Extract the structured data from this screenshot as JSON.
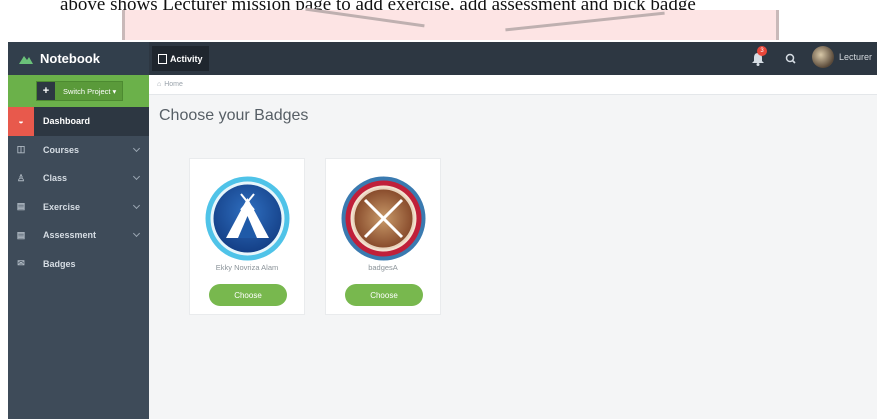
{
  "caption": {
    "text": "above shows Lecturer mission page to add exercise, add assessment and pick badge"
  },
  "topbar": {
    "brand": "Notebook",
    "activity_tab": "Activity",
    "notification_count": "3",
    "user_name": "Lecturer"
  },
  "sidebar": {
    "switch_project": "Switch Project",
    "items": [
      {
        "label": "Dashboard",
        "icon": "dashboard-icon",
        "active": true
      },
      {
        "label": "Courses",
        "icon": "columns-icon",
        "has_submenu": true
      },
      {
        "label": "Class",
        "icon": "user-icon",
        "has_submenu": true
      },
      {
        "label": "Exercise",
        "icon": "file-icon",
        "has_submenu": true
      },
      {
        "label": "Assessment",
        "icon": "file-icon",
        "has_submenu": true
      },
      {
        "label": "Badges",
        "icon": "envelope-icon"
      }
    ]
  },
  "main": {
    "breadcrumb": "Home",
    "title": "Choose your Badges",
    "badges": [
      {
        "name": "Ekky Novriza Alam",
        "button": "Choose",
        "icon": "tent-badge-icon"
      },
      {
        "name": "badgesA",
        "button": "Choose",
        "icon": "crossed-swords-badge-icon"
      }
    ]
  },
  "colors": {
    "topbar": "#2d3742",
    "sidebar": "#3e4b59",
    "accent_green": "#78b84e",
    "active_red": "#e8594c"
  }
}
